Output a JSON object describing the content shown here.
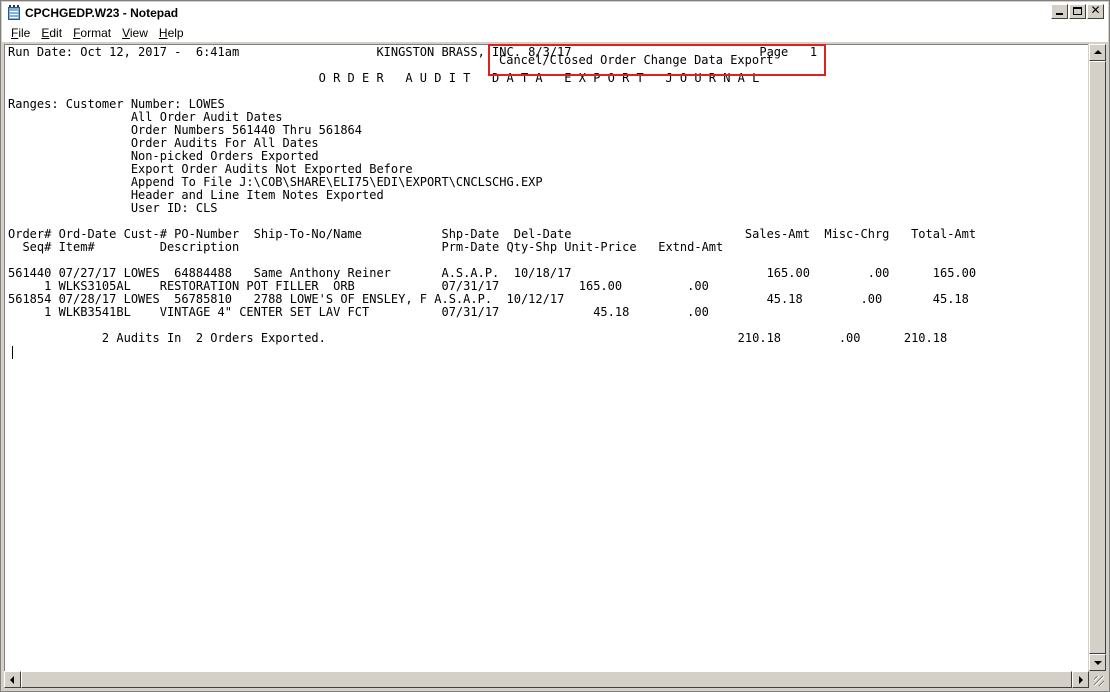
{
  "window": {
    "title": "CPCHGEDP.W23 - Notepad"
  },
  "menu": {
    "file": {
      "acc": "F",
      "rest": "ile"
    },
    "edit": {
      "acc": "E",
      "rest": "dit"
    },
    "format": {
      "acc": "F",
      "rest": "ormat"
    },
    "view": {
      "acc": "V",
      "rest": "iew"
    },
    "help": {
      "acc": "H",
      "rest": "elp"
    }
  },
  "document": {
    "content": "Run Date: Oct 12, 2017 -  6:41am                   KINGSTON BRASS, INC. 8/3/17                          Page   1\n\n                                           O R D E R   A U D I T   D A T A   E X P O R T   J O U R N A L\n\nRanges: Customer Number: LOWES\n                 All Order Audit Dates\n                 Order Numbers 561440 Thru 561864\n                 Order Audits For All Dates\n                 Non-picked Orders Exported\n                 Export Order Audits Not Exported Before\n                 Append To File J:\\COB\\SHARE\\ELI75\\EDI\\EXPORT\\CNCLSCHG.EXP\n                 Header and Line Item Notes Exported\n                 User ID: CLS\n\nOrder# Ord-Date Cust-# PO-Number  Ship-To-No/Name           Shp-Date  Del-Date                        Sales-Amt  Misc-Chrg   Total-Amt\n  Seq# Item#         Description                            Prm-Date Qty-Shp Unit-Price   Extnd-Amt\n\n561440 07/27/17 LOWES  64884488   Same Anthony Reiner       A.S.A.P.  10/18/17                           165.00        .00      165.00\n     1 WLKS3105AL    RESTORATION POT FILLER  ORB            07/31/17           165.00         .00\n561854 07/28/17 LOWES  56785810   2788 LOWE'S OF ENSLEY, F A.S.A.P.  10/12/17                            45.18        .00       45.18\n     1 WLKB3541BL    VINTAGE 4\" CENTER SET LAV FCT          07/31/17             45.18        .00\n\n             2 Audits In  2 Orders Exported.                                                         210.18        .00      210.18",
    "highlight_text": "Cancel/Closed Order Change Data Export"
  },
  "colors": {
    "highlight_border": "#e0201d",
    "chrome": "#d4d0c8",
    "editor_bg": "#ffffff"
  },
  "icons": {
    "app": "notepad-icon",
    "minimize": "minimize-icon",
    "maximize": "maximize-icon",
    "close": "close-icon"
  }
}
